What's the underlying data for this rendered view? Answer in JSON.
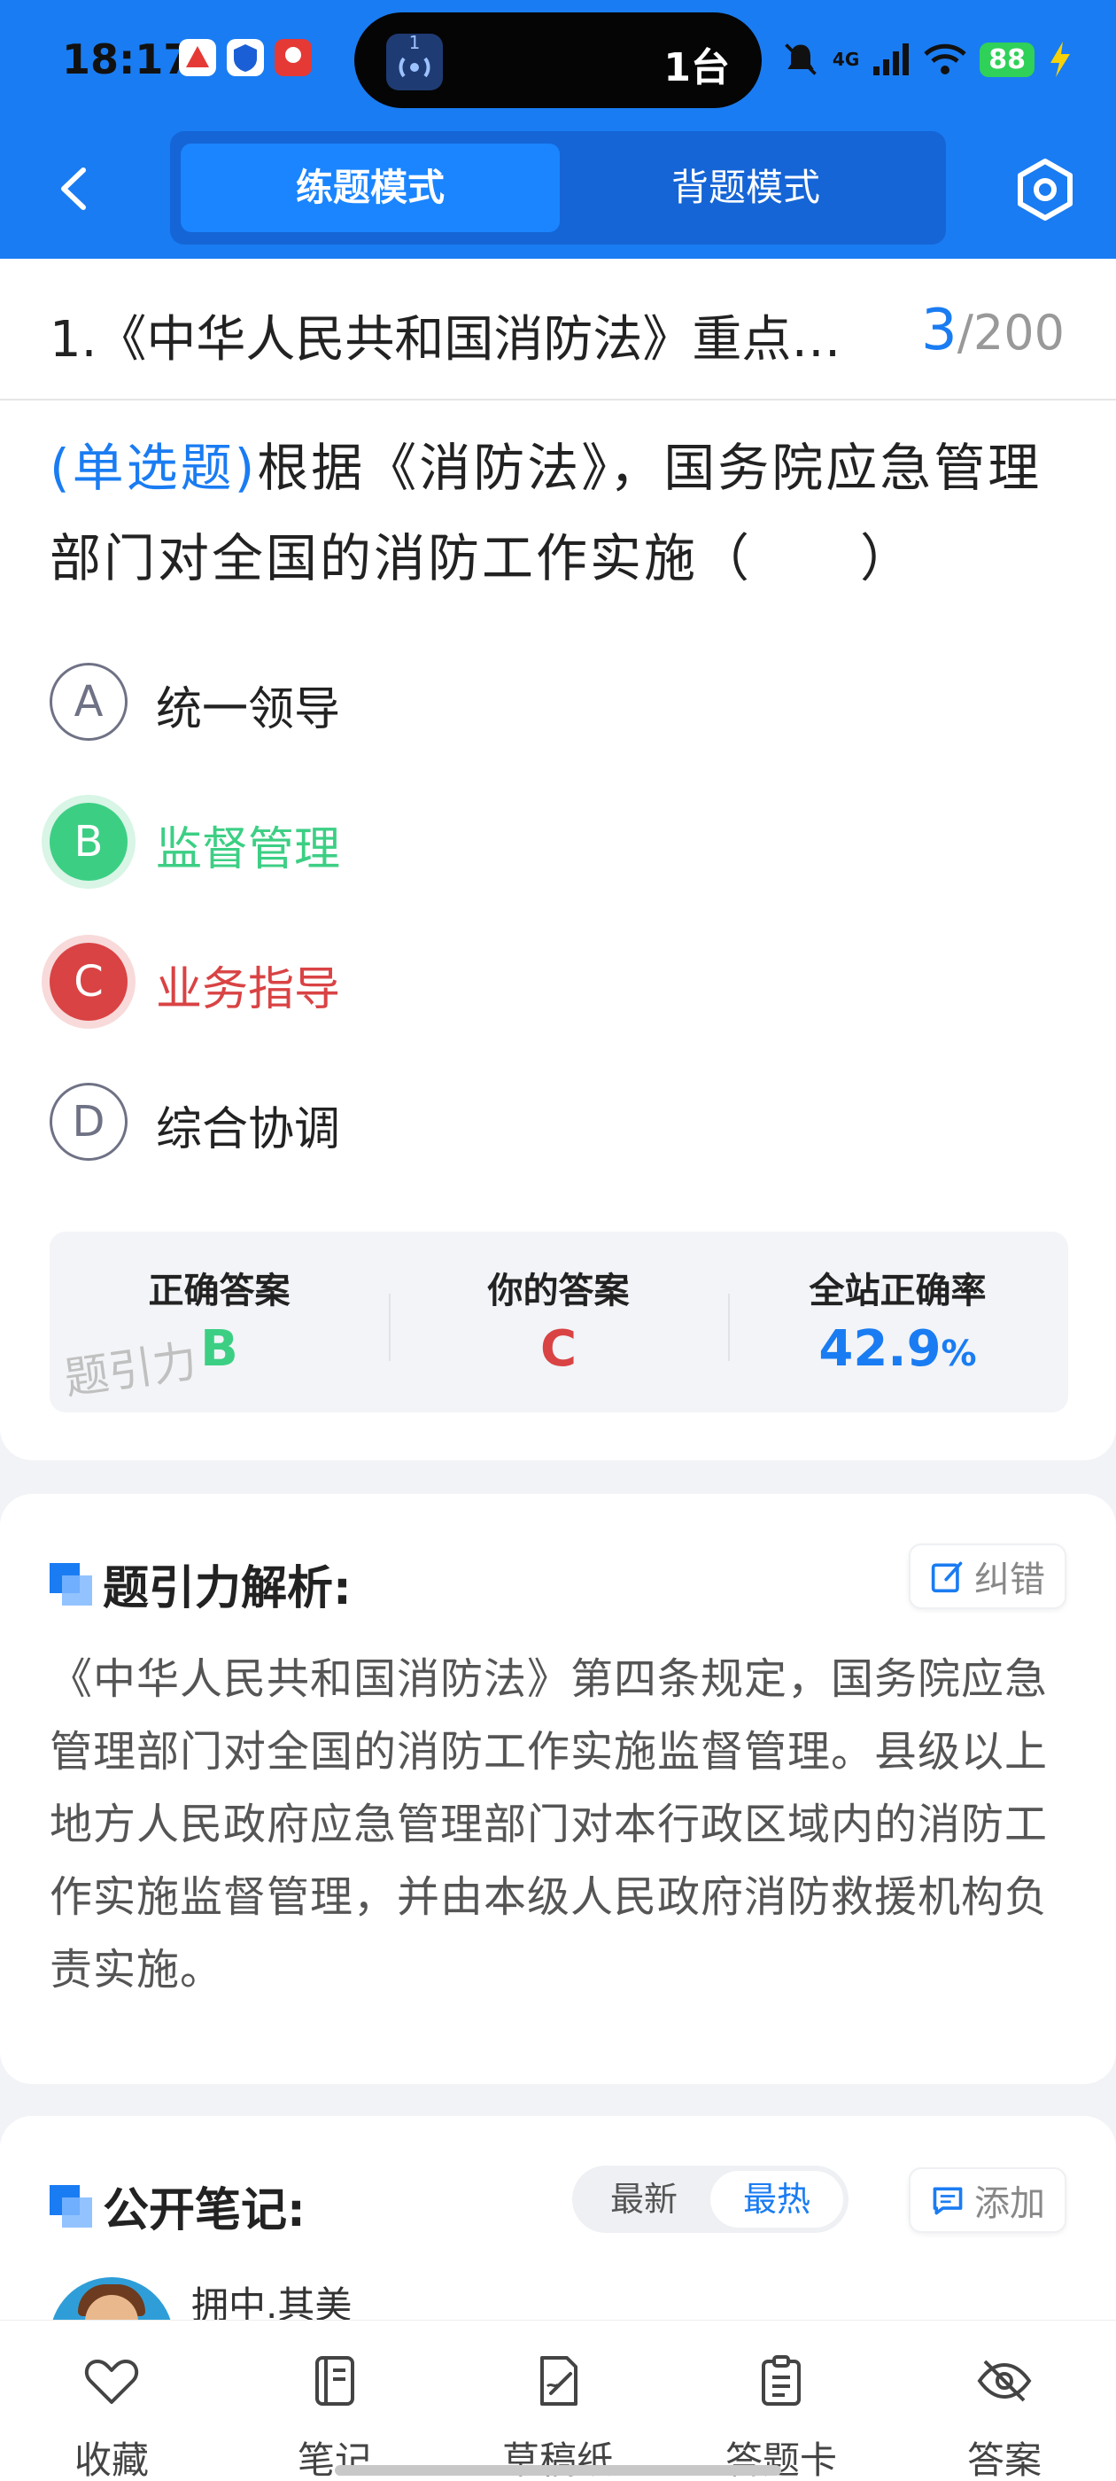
{
  "status_bar": {
    "time": "18:17",
    "island_counter": "1",
    "island_text": "1台",
    "network": "4G",
    "battery": "88"
  },
  "header": {
    "tabs": [
      {
        "label": "练题模式",
        "active": true
      },
      {
        "label": "背题模式",
        "active": false
      }
    ],
    "accent_color": "#1a7cf2"
  },
  "question": {
    "chapter_title": "1.《中华人民共和国消防法》重点…",
    "current": "3",
    "separator": "/",
    "total": "200",
    "type": "(单选题)",
    "text": "根据《消防法》，国务院应急管理部门对全国的消防工作实施（　　）",
    "options": [
      {
        "letter": "A",
        "text": "统一领导",
        "state": "normal"
      },
      {
        "letter": "B",
        "text": "监督管理",
        "state": "correct"
      },
      {
        "letter": "C",
        "text": "业务指导",
        "state": "wrong"
      },
      {
        "letter": "D",
        "text": "综合协调",
        "state": "normal"
      }
    ]
  },
  "answer_summary": {
    "correct_label": "正确答案",
    "correct_value": "B",
    "yours_label": "你的答案",
    "yours_value": "C",
    "rate_label": "全站正确率",
    "rate_value": "42.9",
    "rate_unit": "%",
    "watermark": "题引力",
    "correct_color": "#3ccf84",
    "wrong_color": "#d94344"
  },
  "analysis": {
    "title": "题引力解析:",
    "report_label": "纠错",
    "text": "《中华人民共和国消防法》第四条规定，国务院应急管理部门对全国的消防工作实施监督管理。县级以上地方人民政府应急管理部门对本行政区域内的消防工作实施监督管理，并由本级人民政府消防救援机构负责实施。"
  },
  "notes": {
    "title": "公开笔记:",
    "sort_options": [
      "最新",
      "最热"
    ],
    "active_sort": "最热",
    "add_label": "添加",
    "first_user": "拥中.其美"
  },
  "toolbar": {
    "items": [
      {
        "label": "收藏",
        "icon": "heart-icon"
      },
      {
        "label": "笔记",
        "icon": "notebook-icon"
      },
      {
        "label": "草稿纸",
        "icon": "draft-pencil-icon"
      },
      {
        "label": "答题卡",
        "icon": "clipboard-icon"
      },
      {
        "label": "答案",
        "icon": "eye-off-icon"
      }
    ]
  }
}
